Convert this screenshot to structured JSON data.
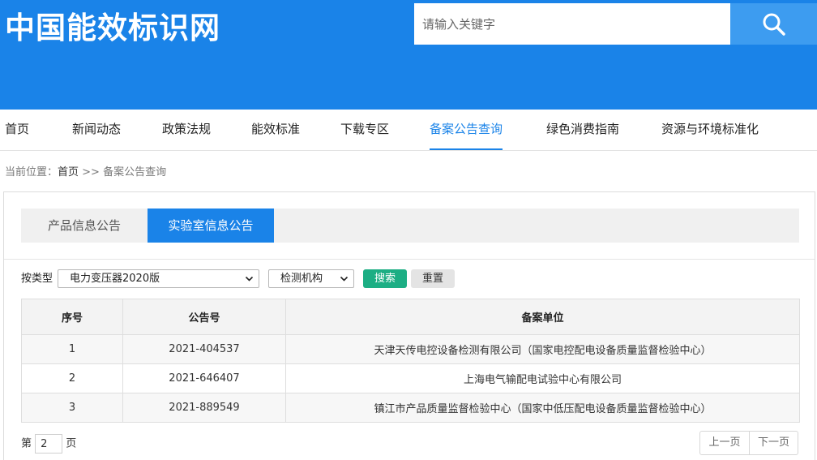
{
  "site": {
    "logo": "中国能效标识网"
  },
  "search": {
    "placeholder": "请输入关键字"
  },
  "nav": {
    "items": [
      "首页",
      "新闻动态",
      "政策法规",
      "能效标准",
      "下载专区",
      "备案公告查询",
      "绿色消费指南",
      "资源与环境标准化"
    ],
    "active_index": 5
  },
  "breadcrumb": {
    "prefix": "当前位置：",
    "home": "首页",
    "separator": " >> ",
    "current": "备案公告查询"
  },
  "tabs": {
    "items": [
      "产品信息公告",
      "实验室信息公告"
    ],
    "active_index": 1
  },
  "filter": {
    "label": "按类型",
    "type_value": "电力变压器2020版",
    "field_value": "检测机构",
    "search_label": "搜索",
    "reset_label": "重置"
  },
  "table": {
    "headers": [
      "序号",
      "公告号",
      "备案单位"
    ],
    "rows": [
      [
        "1",
        "2021-404537",
        "天津天传电控设备检测有限公司（国家电控配电设备质量监督检验中心）"
      ],
      [
        "2",
        "2021-646407",
        "上海电气输配电试验中心有限公司"
      ],
      [
        "3",
        "2021-889549",
        "镇江市产品质量监督检验中心（国家中低压配电设备质量监督检验中心）"
      ]
    ]
  },
  "pagination": {
    "prefix": "第",
    "page": "2",
    "suffix": "页",
    "prev_label": "上一页",
    "next_label": "下一页"
  },
  "colors": {
    "brand": "#1a83e8",
    "search_button": "#3d9cf0",
    "confirm": "#1cae84"
  }
}
